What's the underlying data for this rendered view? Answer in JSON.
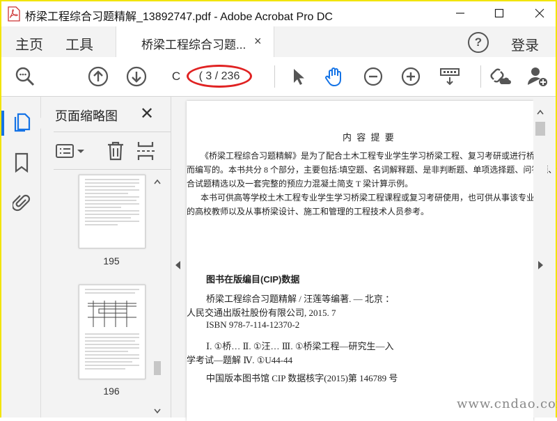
{
  "window": {
    "title": "桥梁工程综合习题精解_13892747.pdf - Adobe Acrobat Pro DC",
    "controls": [
      "minimize-icon",
      "maximize-icon",
      "close-icon"
    ]
  },
  "tabs": {
    "home": "主页",
    "tools": "工具",
    "document": "桥梁工程综合习题...",
    "document_close": "×",
    "help": "?",
    "login": "登录"
  },
  "toolbar": {
    "page_input": "C",
    "page_count": "( 3 / 236",
    "icons": [
      "search-zoom-icon",
      "prev-page-icon",
      "next-page-icon",
      "select-arrow-icon",
      "hand-tool-icon",
      "zoom-out-icon",
      "zoom-in-icon",
      "scroll-mode-icon",
      "share-link-icon",
      "add-user-icon"
    ],
    "accent": "#1473e6",
    "highlight": "#e02222"
  },
  "sidebar_panel": {
    "title": "页面缩略图",
    "close": "✕",
    "thumbnails": [
      {
        "label": "195"
      },
      {
        "label": "196"
      }
    ]
  },
  "document": {
    "heading": "内 容 提 要",
    "para1_line1": "《桥梁工程综合习题精解》是为了配合土木工程专业学生学习桥梁工程、复习考研或进行桥梁",
    "para1_line2": "而编写的。本书共分 8 个部分，主要包括:填空题、名词解释题、是非判断题、单项选择题、问答题、计",
    "para1_line3": "合试题精选以及一套完整的预应力混凝土简支 T 梁计算示例。",
    "para2_line1": "本书可供高等学校土木工程专业学生学习桥梁工程课程或复习考研使用，也可供从事该专业",
    "para2_line2": "的高校教师以及从事桥梁设计、施工和管理的工程技术人员参考。",
    "cip_heading": "图书在版编目(CIP)数据",
    "cip_line1": "桥梁工程综合习题精解 / 汪莲等编著. — 北京 ：",
    "cip_line2": "人民交通出版社股份有限公司, 2015. 7",
    "cip_line3": "ISBN 978-7-114-12370-2",
    "cip_line4": "Ⅰ. ①桥…   Ⅱ. ①汪…   Ⅲ. ①桥梁工程—研究生—入",
    "cip_line5": "学考试—题解   Ⅳ. ①U44-44",
    "cip_line6": "中国版本图书馆 CIP 数据核字(2015)第 146789 号"
  },
  "watermark": "www.cndao.com"
}
